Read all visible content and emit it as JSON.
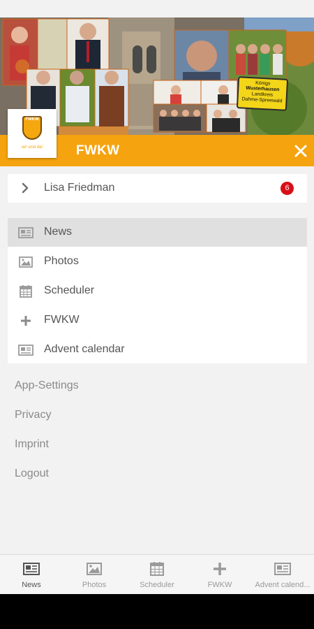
{
  "app": {
    "title": "FWKW",
    "logo_text": "FWKW",
    "logo_slogan": "wir sind da!",
    "accent_color": "#f5a30e"
  },
  "header": {
    "sign_lines": [
      "Königs",
      "Wusterhausen",
      "Landkreis",
      "Dahme-Spreewald"
    ]
  },
  "user": {
    "name": "Lisa Friedman",
    "badge_count": "6",
    "badge_color": "#d90f17"
  },
  "menu": {
    "items": [
      {
        "label": "News",
        "icon": "newspaper-icon",
        "active": true
      },
      {
        "label": "Photos",
        "icon": "image-icon",
        "active": false
      },
      {
        "label": "Scheduler",
        "icon": "calendar-icon",
        "active": false
      },
      {
        "label": "FWKW",
        "icon": "plus-icon",
        "active": false
      },
      {
        "label": "Advent calendar",
        "icon": "newspaper-icon",
        "active": false
      }
    ]
  },
  "links": [
    "App-Settings",
    "Privacy",
    "Imprint",
    "Logout"
  ],
  "bottom_nav": {
    "items": [
      {
        "label": "News",
        "icon": "newspaper-icon",
        "active": true
      },
      {
        "label": "Photos",
        "icon": "image-icon",
        "active": false
      },
      {
        "label": "Scheduler",
        "icon": "calendar-icon",
        "active": false
      },
      {
        "label": "FWKW",
        "icon": "plus-icon",
        "active": false
      },
      {
        "label": "Advent calend...",
        "icon": "newspaper-icon",
        "active": false
      }
    ]
  }
}
